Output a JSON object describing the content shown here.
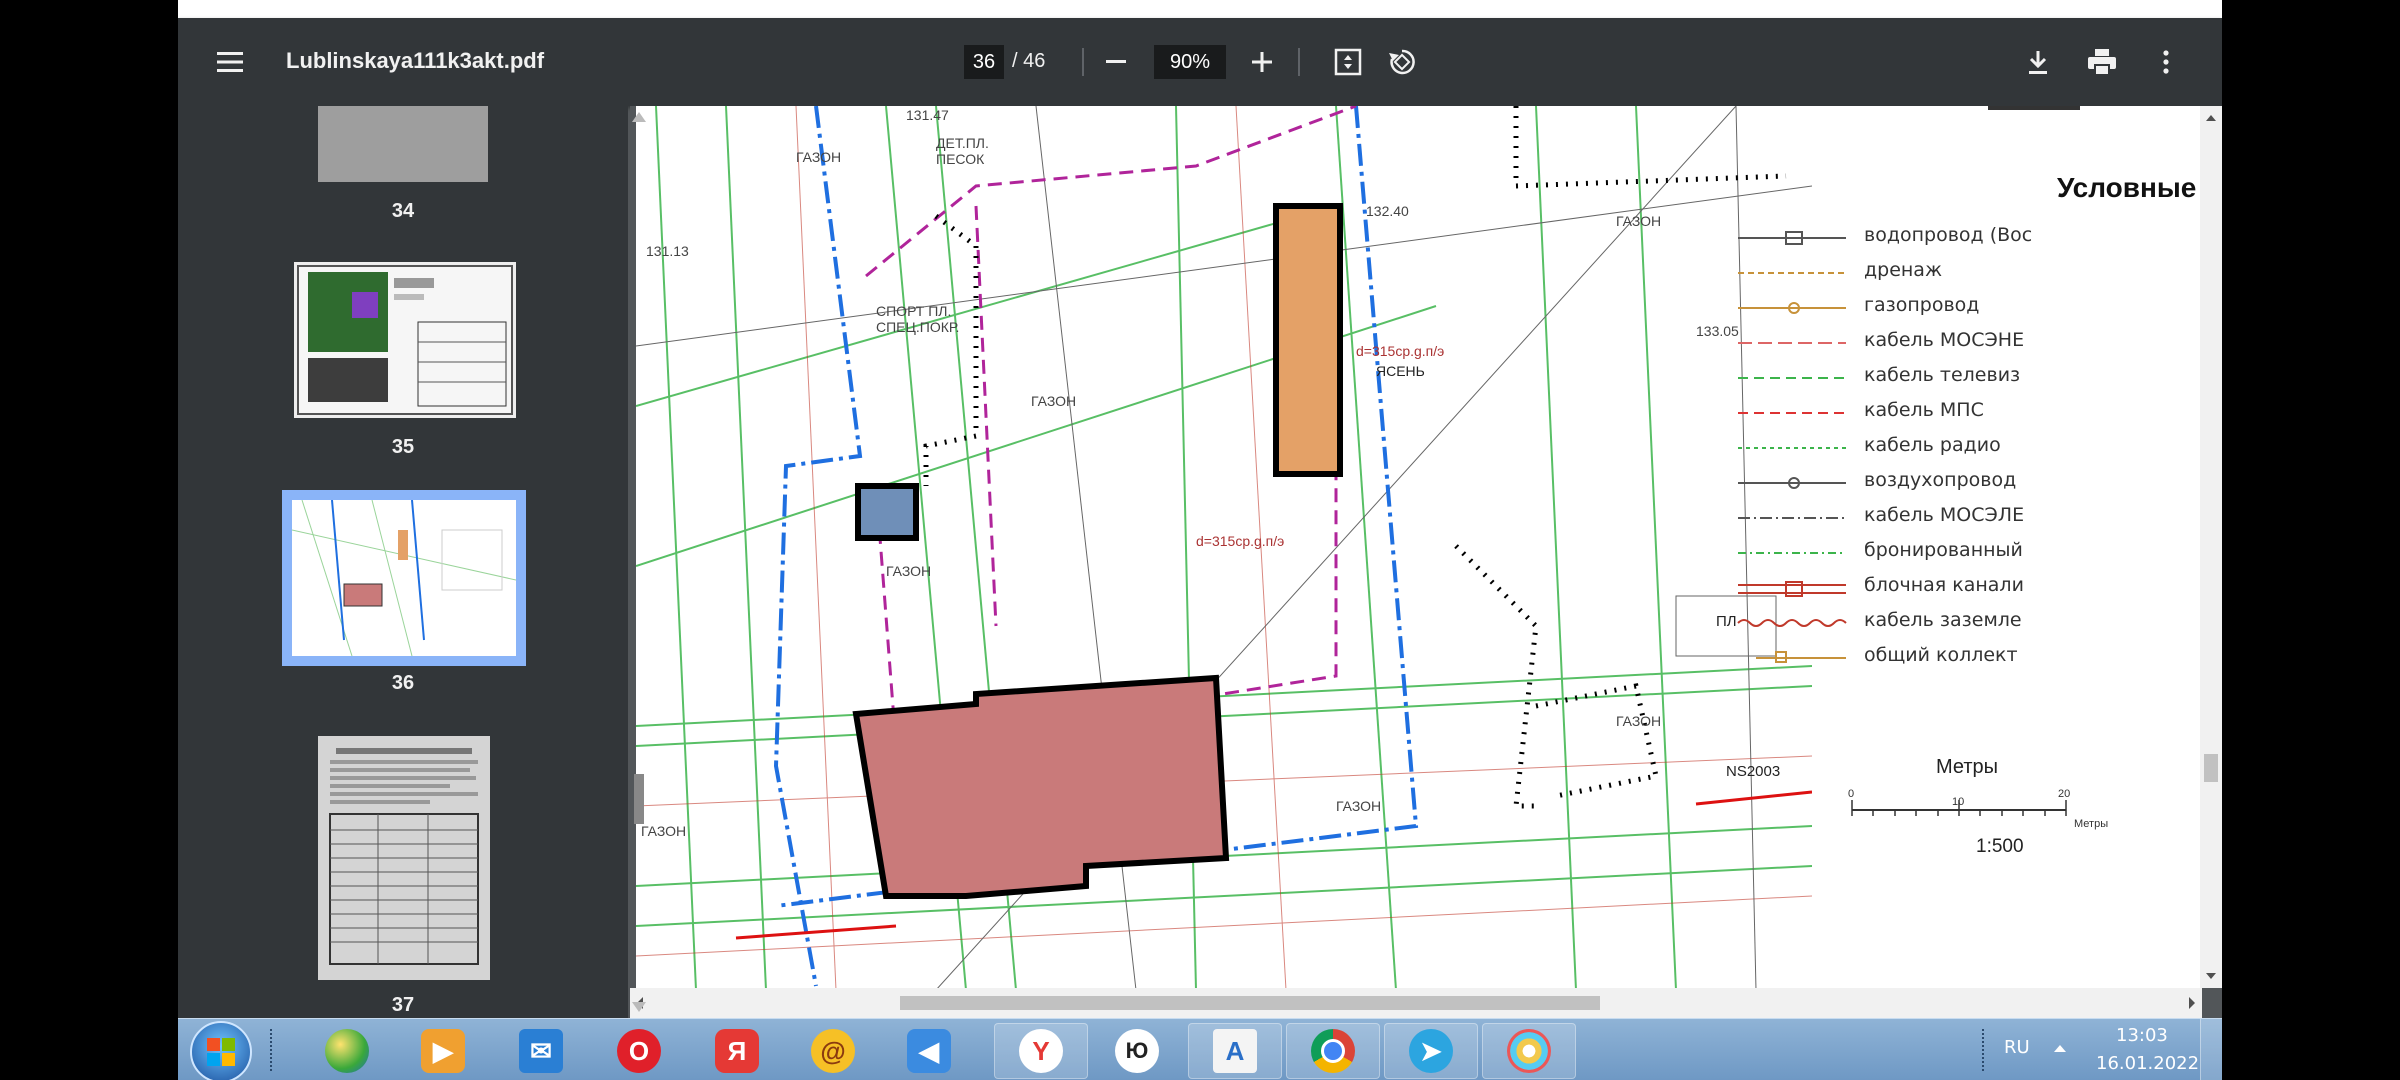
{
  "toolbar": {
    "title": "Lublinskaya111k3akt.pdf",
    "current_page": "36",
    "page_separator": "/",
    "total_pages": "46",
    "zoom": "90%"
  },
  "sidebar": {
    "thumbnails": [
      {
        "label": "34",
        "selected": false
      },
      {
        "label": "35",
        "selected": false
      },
      {
        "label": "36",
        "selected": true
      },
      {
        "label": "37",
        "selected": false
      }
    ]
  },
  "document": {
    "legend_title": "Условные обоз",
    "legend_items": [
      "водопровод (Вос",
      "дренаж",
      "газопровод",
      "кабель МОСЭНЕ",
      "кабель телевиз",
      "кабель МПС",
      "кабель радио",
      "воздухопровод",
      "кабель МОСЭЛЕ",
      "бронированный",
      "блочная канали",
      "кабель заземле",
      "общий коллект"
    ],
    "scale_title": "Метры",
    "scale_ratio": "1:500",
    "scale_ticks": [
      "0",
      "10",
      "20"
    ],
    "scale_unit": "Метры",
    "map_labels": {
      "lawn": "ГАЗОН",
      "sport": "СПОРТ ПЛ. СПЕЦ.ПОКР.",
      "det": "ДЕТ.ПЛ. ПЕСОК",
      "gas": "d=315ср.g.п/э",
      "pl": "ПЛ",
      "ns": "NS2003",
      "yasen": "ЯСЕНЬ",
      "elev1": "131.47",
      "elev2": "131.13",
      "elev3": "132.40",
      "elev4": "133.05"
    }
  },
  "taskbar": {
    "lang": "RU",
    "time": "13:03",
    "date": "16.01.2022"
  },
  "colors": {
    "toolbar": "#323639",
    "viewer_bg": "#525659",
    "selected_thumb": "#8ab4f8",
    "building_fill": "#c97a7a",
    "orange_building": "#e4a167",
    "blue_line": "#1f6fe0",
    "green_line": "#3cb44b",
    "magenta_line": "#b0249a"
  }
}
